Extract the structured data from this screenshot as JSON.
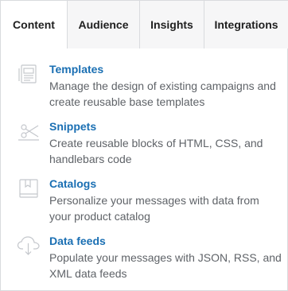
{
  "tabs": [
    {
      "label": "Content",
      "active": true
    },
    {
      "label": "Audience",
      "active": false
    },
    {
      "label": "Insights",
      "active": false
    },
    {
      "label": "Integrations",
      "active": false
    }
  ],
  "menu": {
    "items": [
      {
        "icon": "templates-icon",
        "title": "Templates",
        "description": "Manage the design of existing campaigns and create reusable base templates"
      },
      {
        "icon": "snippets-icon",
        "title": "Snippets",
        "description": "Create reusable blocks of HTML, CSS, and handlebars code"
      },
      {
        "icon": "catalog-book-icon",
        "title": "Catalogs",
        "description": "Personalize your messages with data from your product catalog"
      },
      {
        "icon": "cloud-download-icon",
        "title": "Data feeds",
        "description": "Populate your messages with JSON, RSS, and XML data feeds"
      }
    ]
  },
  "colors": {
    "link": "#1a6fb3",
    "description": "#5f6368",
    "border": "#d9dbde",
    "inactive_tab_bg": "#f6f6f7",
    "icon_stroke": "#c4c7cc"
  }
}
